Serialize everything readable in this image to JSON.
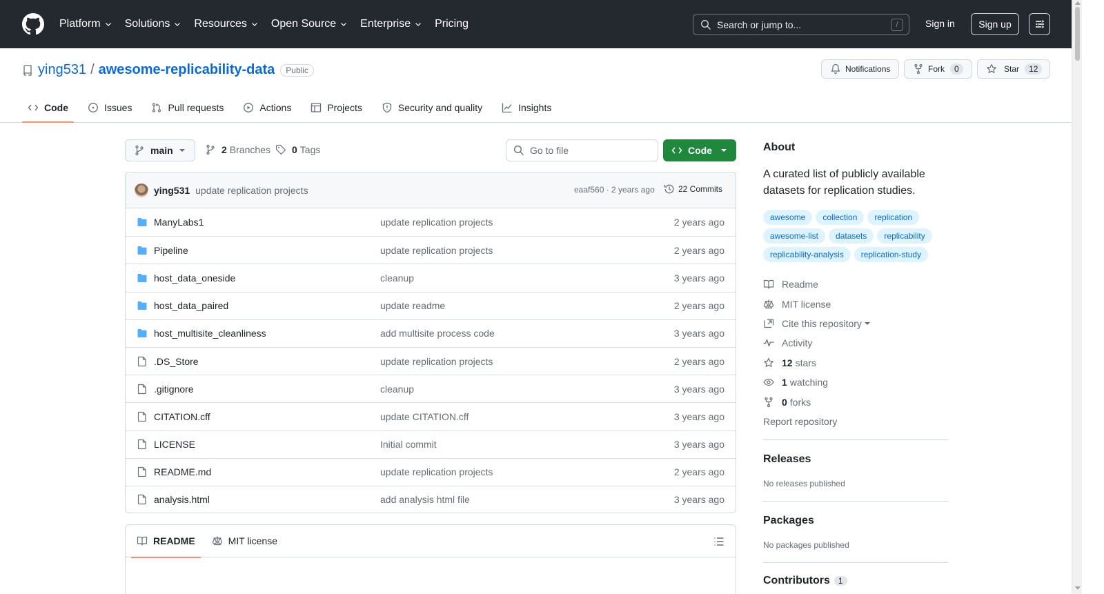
{
  "header": {
    "nav": [
      "Platform",
      "Solutions",
      "Resources",
      "Open Source",
      "Enterprise",
      "Pricing"
    ],
    "search_placeholder": "Search or jump to...",
    "search_shortcut": "/",
    "signin": "Sign in",
    "signup": "Sign up"
  },
  "repo": {
    "owner": "ying531",
    "separator": "/",
    "name": "awesome-replicability-data",
    "visibility": "Public",
    "notifications_label": "Notifications",
    "fork_label": "Fork",
    "fork_count": "0",
    "star_label": "Star",
    "star_count": "12"
  },
  "tabs": [
    "Code",
    "Issues",
    "Pull requests",
    "Actions",
    "Projects",
    "Security and quality",
    "Insights"
  ],
  "branch": {
    "name": "main",
    "branches_count": "2",
    "branches_label": "Branches",
    "tags_count": "0",
    "tags_label": "Tags",
    "goto_placeholder": "Go to file",
    "code_button": "Code"
  },
  "latest_commit": {
    "user": "ying531",
    "message": "update replication projects",
    "hash_time": "eaaf560 · 2 years ago",
    "commits": "22 Commits"
  },
  "files": [
    {
      "name": "ManyLabs1",
      "type": "dir",
      "message": "update replication projects",
      "date": "2 years ago"
    },
    {
      "name": "Pipeline",
      "type": "dir",
      "message": "update replication projects",
      "date": "2 years ago"
    },
    {
      "name": "host_data_oneside",
      "type": "dir",
      "message": "cleanup",
      "date": "3 years ago"
    },
    {
      "name": "host_data_paired",
      "type": "dir",
      "message": "update readme",
      "date": "2 years ago"
    },
    {
      "name": "host_multisite_cleanliness",
      "type": "dir",
      "message": "add multisite process code",
      "date": "3 years ago"
    },
    {
      "name": ".DS_Store",
      "type": "file",
      "message": "update replication projects",
      "date": "2 years ago"
    },
    {
      "name": ".gitignore",
      "type": "file",
      "message": "cleanup",
      "date": "3 years ago"
    },
    {
      "name": "CITATION.cff",
      "type": "file",
      "message": "update CITATION.cff",
      "date": "3 years ago"
    },
    {
      "name": "LICENSE",
      "type": "file",
      "message": "Initial commit",
      "date": "3 years ago"
    },
    {
      "name": "README.md",
      "type": "file",
      "message": "update replication projects",
      "date": "2 years ago"
    },
    {
      "name": "analysis.html",
      "type": "file",
      "message": "add analysis html file",
      "date": "3 years ago"
    }
  ],
  "readme_tabs": [
    "README",
    "MIT license"
  ],
  "about": {
    "title": "About",
    "description": "A curated list of publicly available datasets for replication studies.",
    "topics": [
      "awesome",
      "collection",
      "replication",
      "awesome-list",
      "datasets",
      "replicability",
      "replicability-analysis",
      "replication-study"
    ],
    "readme": "Readme",
    "license": "MIT license",
    "cite": "Cite this repository",
    "activity": "Activity",
    "stars_count": "12",
    "stars_label": "stars",
    "watching_count": "1",
    "watching_label": "watching",
    "forks_count": "0",
    "forks_label": "forks",
    "report": "Report repository"
  },
  "releases": {
    "title": "Releases",
    "empty": "No releases published"
  },
  "packages": {
    "title": "Packages",
    "empty": "No packages published"
  },
  "contributors": {
    "title": "Contributors",
    "count": "1"
  },
  "colors": {
    "accent": "#0969da",
    "header_bg": "#24292f",
    "code_button": "#1f883d",
    "tab_underline": "#fd8c73",
    "folder": "#54aeff"
  }
}
